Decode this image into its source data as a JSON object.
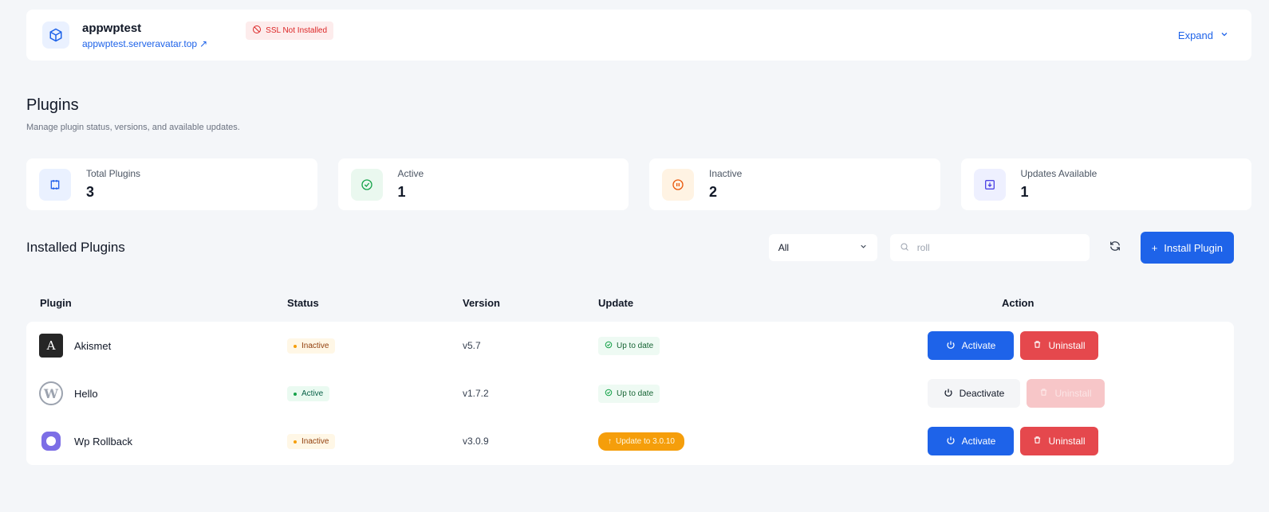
{
  "site": {
    "name": "appwptest",
    "url": "appwptest.serveravatar.top",
    "ssl_status": "SSL Not Installed",
    "expand_label": "Expand"
  },
  "page": {
    "title": "Plugins",
    "subtitle": "Manage plugin status, versions, and available updates."
  },
  "stats": [
    {
      "label": "Total Plugins",
      "value": "3",
      "icon": "plugin-icon",
      "color": "#2563eb",
      "bg": "#eaf1ff"
    },
    {
      "label": "Active",
      "value": "1",
      "icon": "check-circle-icon",
      "color": "#16a34a",
      "bg": "#eaf8ef"
    },
    {
      "label": "Inactive",
      "value": "2",
      "icon": "pause-circle-icon",
      "color": "#ea580c",
      "bg": "#fff3e3"
    },
    {
      "label": "Updates Available",
      "value": "1",
      "icon": "download-box-icon",
      "color": "#4f46e5",
      "bg": "#eef0ff"
    }
  ],
  "toolbar": {
    "title": "Installed Plugins",
    "filter_value": "All",
    "search_value": "roll",
    "install_label": "Install Plugin"
  },
  "table": {
    "columns": [
      "Plugin",
      "Status",
      "Version",
      "Update",
      "Action"
    ],
    "rows": [
      {
        "name": "Akismet",
        "status": "Inactive",
        "version": "v5.7",
        "update": "Up to date",
        "primary_action": "Activate",
        "secondary_action": "Uninstall"
      },
      {
        "name": "Hello",
        "status": "Active",
        "version": "v1.7.2",
        "update": "Up to date",
        "primary_action": "Deactivate",
        "secondary_action": "Uninstall"
      },
      {
        "name": "Wp Rollback",
        "status": "Inactive",
        "version": "v3.0.9",
        "update": "Update to 3.0.10",
        "primary_action": "Activate",
        "secondary_action": "Uninstall"
      }
    ]
  },
  "colors": {
    "accent": "#1e63e9",
    "danger": "#e5484d",
    "warning": "#f59e0b",
    "success": "#16a34a"
  }
}
